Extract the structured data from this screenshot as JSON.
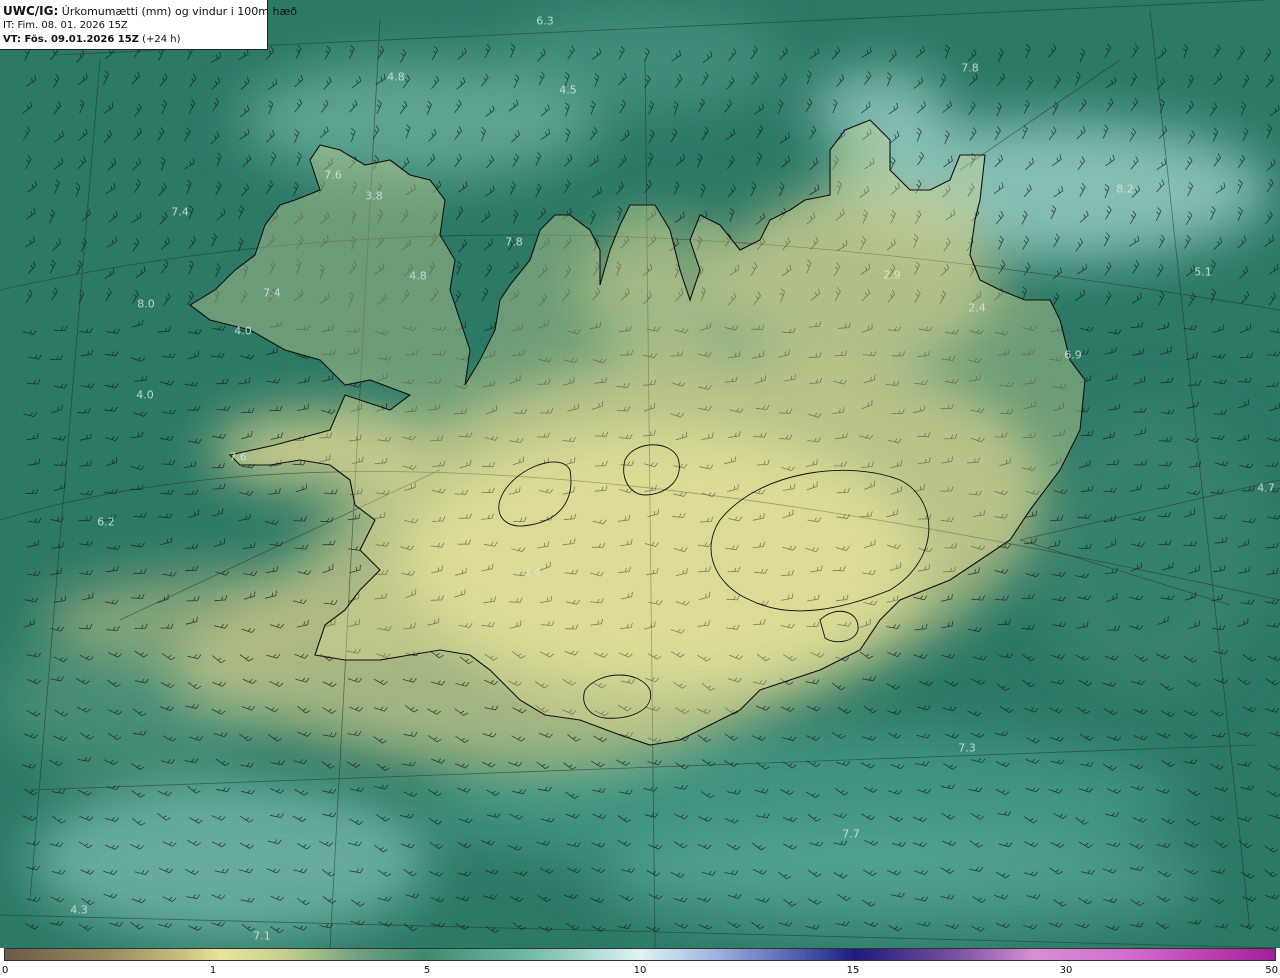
{
  "header": {
    "title_model": "UWC/IG:",
    "title_text": "Úrkomumætti (mm) og vindur i 100m hæð",
    "init_time": "IT: Fim. 08. 01. 2026 15Z",
    "valid_label": "VT: Fös. 09.01.2026 15Z",
    "lead_time": "(+24 h)"
  },
  "map_labels": [
    "6.3",
    "7.8",
    "4.8",
    "4.5",
    "7.6",
    "3.8",
    "7.4",
    "7.8",
    "4.8",
    "7.4",
    "8.0",
    "4.0",
    "2.9",
    "2.4",
    "5.1",
    "6.9",
    "4.0",
    "7.6",
    "6.2",
    "3.4",
    "4.7",
    "8.2",
    "7.3",
    "7.7",
    "4.3",
    "7.1"
  ],
  "colorbar": {
    "ticks": [
      "0",
      "1",
      "5",
      "10",
      "15",
      "30",
      "50"
    ]
  },
  "colors": {
    "sea_low_precip": "#2e7a68",
    "land_low_precip": "#e2de95",
    "high_precip": "#b8e6e2",
    "coastline": "#111111"
  }
}
